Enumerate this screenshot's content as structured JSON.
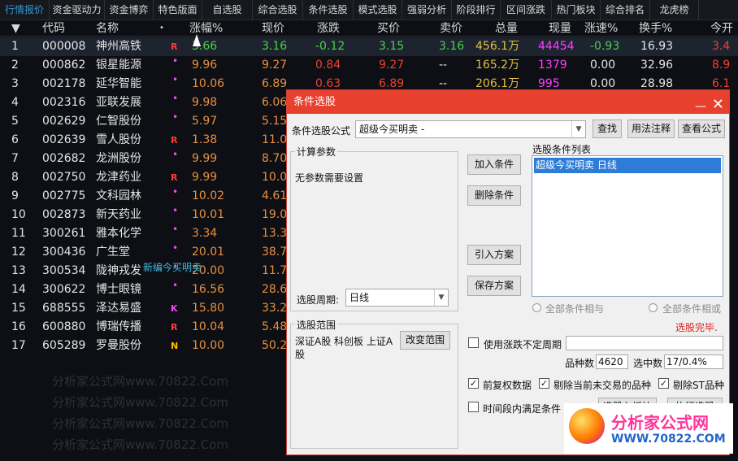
{
  "tabs": [
    "行情报价",
    "资金驱动力",
    "资金博弈",
    "特色版面",
    "自选股",
    "综合选股",
    "条件选股",
    "模式选股",
    "强弱分析",
    "阶段排行",
    "区间涨跌",
    "热门板块",
    "综合排名",
    "龙虎榜"
  ],
  "columns": {
    "sort": "▼",
    "code": "代码",
    "name": "名称",
    "dot": "•",
    "pct": "涨幅%",
    "price": "现价",
    "chg": "涨跌",
    "bid": "买价",
    "ask": "卖价",
    "vol": "总量",
    "cur": "现量",
    "speed": "涨速%",
    "turn": "换手%",
    "open": "今开"
  },
  "rows": [
    {
      "idx": "1",
      "code": "000008",
      "name": "神州高铁",
      "tag": "R",
      "pct": "3.66",
      "price": "3.16",
      "chg": "-0.12",
      "bid": "3.15",
      "ask": "3.16",
      "vol": "456.1万",
      "cur": "44454",
      "speed": "-0.93",
      "turn": "16.93",
      "open": "3.4"
    },
    {
      "idx": "2",
      "code": "000862",
      "name": "银星能源",
      "tag": "",
      "pct": "9.96",
      "price": "9.27",
      "chg": "0.84",
      "bid": "9.27",
      "ask": "--",
      "vol": "165.2万",
      "cur": "1379",
      "speed": "0.00",
      "turn": "32.96",
      "open": "8.9"
    },
    {
      "idx": "3",
      "code": "002178",
      "name": "延华智能",
      "tag": "",
      "pct": "10.06",
      "price": "6.89",
      "chg": "0.63",
      "bid": "6.89",
      "ask": "--",
      "vol": "206.1万",
      "cur": "995",
      "speed": "0.00",
      "turn": "28.98",
      "open": "6.1"
    },
    {
      "idx": "4",
      "code": "002316",
      "name": "亚联发展",
      "tag": "",
      "pct": "9.98",
      "price": "6.06",
      "chg": "",
      "bid": "",
      "ask": "",
      "vol": "",
      "cur": "",
      "speed": "",
      "turn": "",
      "open": ""
    },
    {
      "idx": "5",
      "code": "002629",
      "name": "仁智股份",
      "tag": "",
      "pct": "5.97",
      "price": "5.15",
      "chg": "",
      "bid": "",
      "ask": "",
      "vol": "",
      "cur": "",
      "speed": "",
      "turn": "",
      "open": ""
    },
    {
      "idx": "6",
      "code": "002639",
      "name": "雪人股份",
      "tag": "R",
      "pct": "1.38",
      "price": "11.03",
      "chg": "",
      "bid": "",
      "ask": "",
      "vol": "",
      "cur": "",
      "speed": "",
      "turn": "",
      "open": ""
    },
    {
      "idx": "7",
      "code": "002682",
      "name": "龙洲股份",
      "tag": "",
      "pct": "9.99",
      "price": "8.70",
      "chg": "",
      "bid": "",
      "ask": "",
      "vol": "",
      "cur": "",
      "speed": "",
      "turn": "",
      "open": ""
    },
    {
      "idx": "8",
      "code": "002750",
      "name": "龙津药业",
      "tag": "R",
      "pct": "9.99",
      "price": "10.02",
      "chg": "",
      "bid": "",
      "ask": "",
      "vol": "",
      "cur": "",
      "speed": "",
      "turn": "",
      "open": ""
    },
    {
      "idx": "9",
      "code": "002775",
      "name": "文科园林",
      "tag": "",
      "pct": "10.02",
      "price": "4.61",
      "chg": "",
      "bid": "",
      "ask": "",
      "vol": "",
      "cur": "",
      "speed": "",
      "turn": "",
      "open": ""
    },
    {
      "idx": "10",
      "code": "002873",
      "name": "新天药业",
      "tag": "",
      "pct": "10.01",
      "price": "19.01",
      "chg": "",
      "bid": "",
      "ask": "",
      "vol": "",
      "cur": "",
      "speed": "",
      "turn": "",
      "open": ""
    },
    {
      "idx": "11",
      "code": "300261",
      "name": "雅本化学",
      "tag": "",
      "pct": "3.34",
      "price": "13.31",
      "chg": "",
      "bid": "",
      "ask": "",
      "vol": "",
      "cur": "",
      "speed": "",
      "turn": "",
      "open": ""
    },
    {
      "idx": "12",
      "code": "300436",
      "name": "广生堂",
      "tag": "",
      "pct": "20.01",
      "price": "38.74",
      "chg": "",
      "bid": "",
      "ask": "",
      "vol": "",
      "cur": "",
      "speed": "",
      "turn": "",
      "open": ""
    },
    {
      "idx": "13",
      "code": "300534",
      "name": "陇神戎发",
      "tag": "",
      "pct": "20.00",
      "price": "11.76",
      "chg": "",
      "bid": "",
      "ask": "",
      "vol": "",
      "cur": "",
      "speed": "",
      "turn": "",
      "open": ""
    },
    {
      "idx": "14",
      "code": "300622",
      "name": "博士眼镜",
      "tag": "",
      "pct": "16.56",
      "price": "28.65",
      "chg": "",
      "bid": "",
      "ask": "",
      "vol": "",
      "cur": "",
      "speed": "",
      "turn": "",
      "open": ""
    },
    {
      "idx": "15",
      "code": "688555",
      "name": "泽达易盛",
      "tag": "K",
      "pct": "15.80",
      "price": "33.20",
      "chg": "",
      "bid": "",
      "ask": "",
      "vol": "",
      "cur": "",
      "speed": "",
      "turn": "",
      "open": ""
    },
    {
      "idx": "16",
      "code": "600880",
      "name": "博瑞传播",
      "tag": "R",
      "pct": "10.04",
      "price": "5.48",
      "chg": "",
      "bid": "",
      "ask": "",
      "vol": "",
      "cur": "",
      "speed": "",
      "turn": "",
      "open": ""
    },
    {
      "idx": "17",
      "code": "605289",
      "name": "罗曼股份",
      "tag": "N",
      "pct": "10.00",
      "price": "50.28",
      "chg": "",
      "bid": "",
      "ask": "",
      "vol": "",
      "cur": "",
      "speed": "",
      "turn": "",
      "open": ""
    }
  ],
  "overlay_note": "新编今买明卖",
  "watermark": "分析家公式网www.70822.Com",
  "dialog": {
    "title": "条件选股",
    "formula_label": "条件选股公式",
    "formula_value": "超级今买明卖 -",
    "btn_find": "查找",
    "btn_usage": "用法注释",
    "btn_view": "查看公式",
    "params_title": "计算参数",
    "params_text": "无参数需要设置",
    "btn_add": "加入条件",
    "btn_delete": "删除条件",
    "btn_import": "引入方案",
    "btn_save": "保存方案",
    "list_title": "选股条件列表",
    "list_items": [
      "超级今买明卖  日线"
    ],
    "period_label": "选股周期:",
    "period_value": "日线",
    "radio_and": "全部条件相与",
    "radio_or": "全部条件相或",
    "status": "选股完毕.",
    "range_title": "选股范围",
    "range_text": "深证A股 科创板 上证A股",
    "btn_range": "改变范围",
    "use_period": "使用涨跌不定周期",
    "count_label": "品种数",
    "count_value": "4620",
    "selected_label": "选中数",
    "selected_value": "17/0.4%",
    "chk_prev": "前复权数据",
    "chk_notrade": "剔除当前未交易的品种",
    "chk_st": "剔除ST品种",
    "chk_interval": "时间段内满足条件",
    "btn_toblock": "选股入板块",
    "btn_run": "执行选股"
  },
  "logo": {
    "title": "分析家公式网",
    "url": "WWW.70822.COM"
  }
}
